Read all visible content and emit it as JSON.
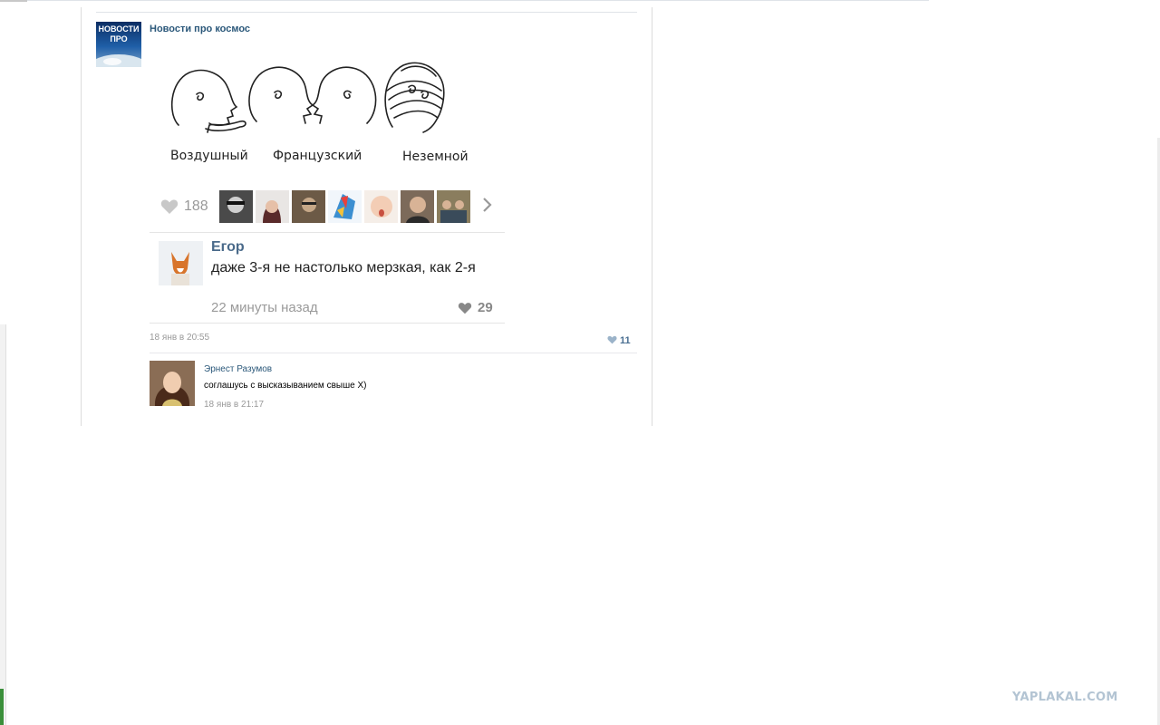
{
  "post": {
    "group_name": "Новости про космос",
    "group_avatar_text_1": "НОВОСТИ",
    "group_avatar_text_2": "ПРО",
    "date": "18 янв в 20:55",
    "likes": "11"
  },
  "meme": {
    "captions": [
      "Воздушный",
      "Французский",
      "Неземной"
    ],
    "like_count": "188",
    "comment": {
      "author": "Егор",
      "text": "даже 3-я не настолько мерзкая, как 2-я",
      "time": "22 минуты назад",
      "likes": "29"
    }
  },
  "reply": {
    "author": "Эрнест Разумов",
    "text": "соглашусь с высказыванием свыше Х)",
    "date": "18 янв в 21:17"
  },
  "watermark": "YAPLAKAL.COM",
  "colors": {
    "link": "#2b587a",
    "meta": "#999999",
    "like_accent": "#4a6f92"
  }
}
